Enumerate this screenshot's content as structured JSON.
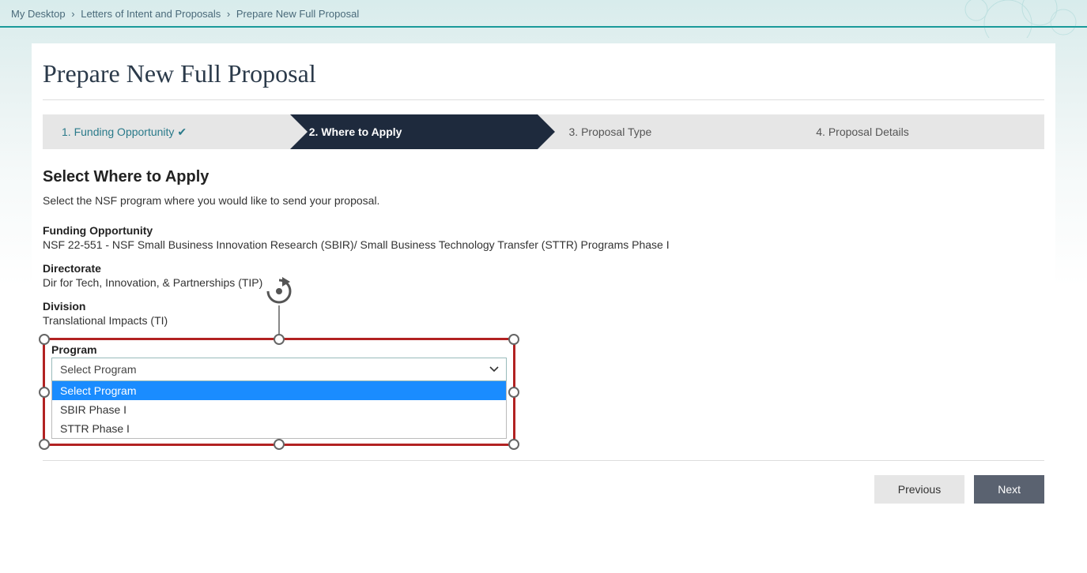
{
  "breadcrumb": {
    "items": [
      {
        "label": "My Desktop"
      },
      {
        "label": "Letters of Intent and Proposals"
      },
      {
        "label": "Prepare New Full Proposal"
      }
    ],
    "separator": "›"
  },
  "page_title": "Prepare New Full Proposal",
  "wizard": {
    "steps": [
      {
        "label": "1. Funding Opportunity",
        "state": "completed"
      },
      {
        "label": "2. Where to Apply",
        "state": "active"
      },
      {
        "label": "3. Proposal Type",
        "state": "upcoming"
      },
      {
        "label": "4. Proposal Details",
        "state": "upcoming"
      }
    ]
  },
  "section": {
    "title": "Select Where to Apply",
    "description": "Select the NSF program where you would like to send your proposal."
  },
  "fields": {
    "funding_opportunity": {
      "label": "Funding Opportunity",
      "value": "NSF 22-551 - NSF Small Business Innovation Research (SBIR)/ Small Business Technology Transfer (STTR) Programs Phase I"
    },
    "directorate": {
      "label": "Directorate",
      "value": "Dir for Tech, Innovation, & Partnerships (TIP)"
    },
    "division": {
      "label": "Division",
      "value": "Translational Impacts (TI)"
    },
    "program": {
      "label": "Program",
      "selected": "Select Program",
      "options": [
        {
          "label": "Select Program",
          "highlighted": true
        },
        {
          "label": "SBIR Phase I",
          "highlighted": false
        },
        {
          "label": "STTR Phase I",
          "highlighted": false
        }
      ]
    }
  },
  "buttons": {
    "previous": "Previous",
    "next": "Next"
  },
  "colors": {
    "accent_teal": "#1a9a9a",
    "wizard_active_bg": "#1e2a3d",
    "highlight_blue": "#1a8cff",
    "annotation_red": "#b22222",
    "next_button_bg": "#5a6270"
  }
}
